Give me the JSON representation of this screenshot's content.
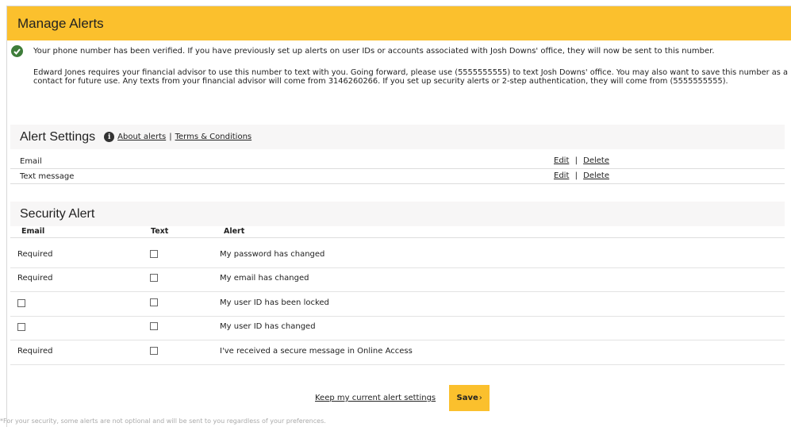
{
  "header": {
    "title": "Manage Alerts"
  },
  "verification": {
    "icon": "check-circle-icon",
    "message": "Your phone number has been verified. If you have previously set up alerts on user IDs or accounts associated with Josh Downs' office, they will now be sent to this number.",
    "details": "Edward Jones requires your financial advisor to use this number to text with you. Going forward, please use (5555555555) to text  Josh Downs' office. You may also want to save this number as a contact for future use. Any texts from your financial advisor will come from 3146260266. If you set up security alerts or 2-step authentication, they will come from (5555555555)."
  },
  "alert_settings": {
    "title": "Alert Settings",
    "info_icon": "info-icon",
    "about_link": "About alerts",
    "separator": "|",
    "terms_link": "Terms & Conditions",
    "rows": [
      {
        "label": "Email",
        "edit": "Edit",
        "sep": "|",
        "delete": "Delete"
      },
      {
        "label": "Text message",
        "edit": "Edit",
        "sep": "|",
        "delete": "Delete"
      }
    ]
  },
  "security_alert": {
    "title": "Security Alert",
    "columns": {
      "email": "Email",
      "text": "Text",
      "alert": "Alert"
    },
    "rows": [
      {
        "email": "Required",
        "text_checked": false,
        "alert": "My password has changed"
      },
      {
        "email": "Required",
        "text_checked": false,
        "alert": "My email has changed"
      },
      {
        "email": "",
        "text_checked": false,
        "alert": "My user ID has been locked"
      },
      {
        "email": "",
        "text_checked": false,
        "alert": "My user ID has changed"
      },
      {
        "email": "Required",
        "text_checked": false,
        "alert": "I've received a secure message in Online Access"
      }
    ]
  },
  "footer": {
    "keep_link": "Keep my current alert settings",
    "save_label": "Save",
    "save_chevron": "›",
    "note": "*For your security, some alerts are not optional and will be sent to you regardless of your preferences."
  },
  "colors": {
    "brand_yellow": "#fbc02d",
    "check_green": "#3e7d3a"
  }
}
